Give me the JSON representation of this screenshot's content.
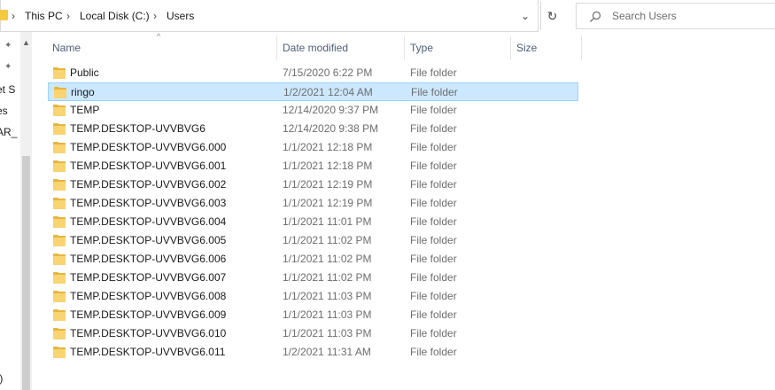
{
  "address": {
    "breadcrumbs": [
      "This PC",
      "Local Disk (C:)",
      "Users"
    ]
  },
  "search": {
    "placeholder": "Search Users"
  },
  "nav_pane": {
    "fragments": [
      "et S",
      "es",
      "AR_",
      ":)"
    ]
  },
  "columns": {
    "name": "Name",
    "date": "Date modified",
    "type": "Type",
    "size": "Size"
  },
  "rows": [
    {
      "name": "Public",
      "date": "7/15/2020 6:22 PM",
      "type": "File folder"
    },
    {
      "name": "ringo",
      "date": "1/2/2021 12:04 AM",
      "type": "File folder"
    },
    {
      "name": "TEMP",
      "date": "12/14/2020 9:37 PM",
      "type": "File folder"
    },
    {
      "name": "TEMP.DESKTOP-UVVBVG6",
      "date": "12/14/2020 9:38 PM",
      "type": "File folder"
    },
    {
      "name": "TEMP.DESKTOP-UVVBVG6.000",
      "date": "1/1/2021 12:18 PM",
      "type": "File folder"
    },
    {
      "name": "TEMP.DESKTOP-UVVBVG6.001",
      "date": "1/1/2021 12:18 PM",
      "type": "File folder"
    },
    {
      "name": "TEMP.DESKTOP-UVVBVG6.002",
      "date": "1/1/2021 12:19 PM",
      "type": "File folder"
    },
    {
      "name": "TEMP.DESKTOP-UVVBVG6.003",
      "date": "1/1/2021 12:19 PM",
      "type": "File folder"
    },
    {
      "name": "TEMP.DESKTOP-UVVBVG6.004",
      "date": "1/1/2021 11:01 PM",
      "type": "File folder"
    },
    {
      "name": "TEMP.DESKTOP-UVVBVG6.005",
      "date": "1/1/2021 11:02 PM",
      "type": "File folder"
    },
    {
      "name": "TEMP.DESKTOP-UVVBVG6.006",
      "date": "1/1/2021 11:02 PM",
      "type": "File folder"
    },
    {
      "name": "TEMP.DESKTOP-UVVBVG6.007",
      "date": "1/1/2021 11:02 PM",
      "type": "File folder"
    },
    {
      "name": "TEMP.DESKTOP-UVVBVG6.008",
      "date": "1/1/2021 11:03 PM",
      "type": "File folder"
    },
    {
      "name": "TEMP.DESKTOP-UVVBVG6.009",
      "date": "1/1/2021 11:03 PM",
      "type": "File folder"
    },
    {
      "name": "TEMP.DESKTOP-UVVBVG6.010",
      "date": "1/1/2021 11:03 PM",
      "type": "File folder"
    },
    {
      "name": "TEMP.DESKTOP-UVVBVG6.011",
      "date": "1/2/2021 11:31 AM",
      "type": "File folder"
    }
  ],
  "selected_row": "ringo",
  "colors": {
    "selection_bg": "#cce8ff",
    "selection_border": "#99d1ff",
    "header_text": "#4c607a",
    "folder_yellow": "#f8d472"
  },
  "icons": {
    "row": "folder-icon",
    "search": "search-icon",
    "refresh": "refresh-icon",
    "pin": "pin-icon"
  }
}
